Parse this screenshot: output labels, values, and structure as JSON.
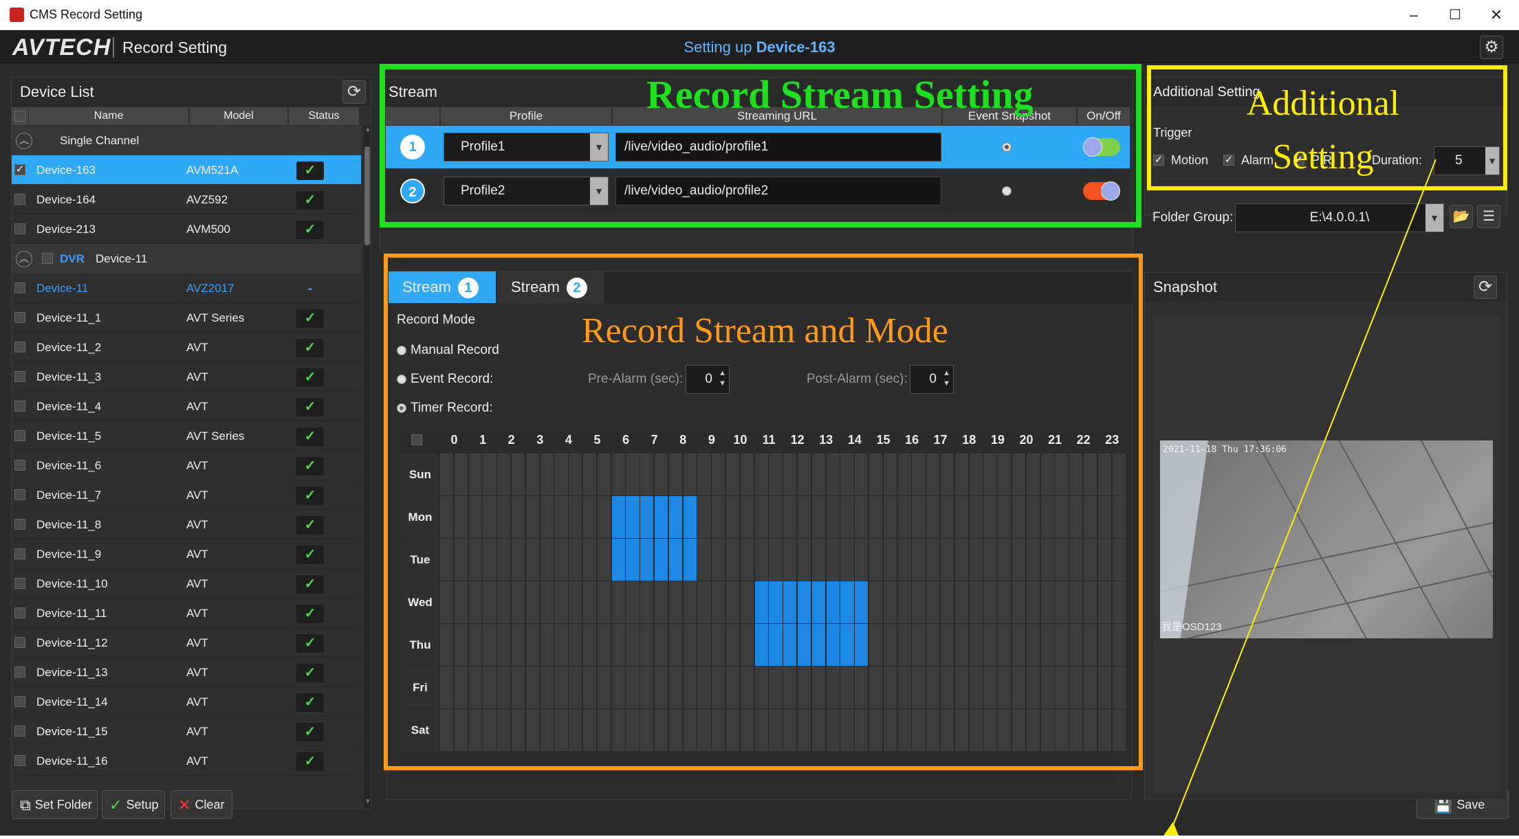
{
  "window": {
    "title": "CMS Record Setting",
    "min": "–",
    "max": "☐",
    "close": "✕"
  },
  "header": {
    "logo": "AVTECH",
    "app_name": "Record Setting",
    "setup_prefix": "Setting up ",
    "device": "Device-163",
    "gear_icon": "gear-icon"
  },
  "device_list": {
    "title": "Device List",
    "columns": [
      "Name",
      "Model",
      "Status"
    ],
    "group1": "Single Channel",
    "single": [
      {
        "name": "Device-163",
        "model": "AVM521A",
        "status": "✓",
        "selected": true,
        "checked": true
      },
      {
        "name": "Device-164",
        "model": "AVZ592",
        "status": "✓"
      },
      {
        "name": "Device-213",
        "model": "AVM500",
        "status": "✓"
      }
    ],
    "group2_type": "DVR",
    "group2_name": "Device-11",
    "dvr": [
      {
        "name": "Device-11",
        "model": "AVZ2017",
        "status": "-",
        "blue": true
      },
      {
        "name": "Device-11_1",
        "model": "AVT Series",
        "status": "✓"
      },
      {
        "name": "Device-11_2",
        "model": "AVT",
        "status": "✓"
      },
      {
        "name": "Device-11_3",
        "model": "AVT",
        "status": "✓"
      },
      {
        "name": "Device-11_4",
        "model": "AVT",
        "status": "✓"
      },
      {
        "name": "Device-11_5",
        "model": "AVT Series",
        "status": "✓"
      },
      {
        "name": "Device-11_6",
        "model": "AVT",
        "status": "✓"
      },
      {
        "name": "Device-11_7",
        "model": "AVT",
        "status": "✓"
      },
      {
        "name": "Device-11_8",
        "model": "AVT",
        "status": "✓"
      },
      {
        "name": "Device-11_9",
        "model": "AVT",
        "status": "✓"
      },
      {
        "name": "Device-11_10",
        "model": "AVT",
        "status": "✓"
      },
      {
        "name": "Device-11_11",
        "model": "AVT",
        "status": "✓"
      },
      {
        "name": "Device-11_12",
        "model": "AVT",
        "status": "✓"
      },
      {
        "name": "Device-11_13",
        "model": "AVT",
        "status": "✓"
      },
      {
        "name": "Device-11_14",
        "model": "AVT",
        "status": "✓"
      },
      {
        "name": "Device-11_15",
        "model": "AVT",
        "status": "✓"
      },
      {
        "name": "Device-11_16",
        "model": "AVT",
        "status": "✓"
      }
    ]
  },
  "buttons": {
    "set_folder": "Set Folder",
    "setup": "Setup",
    "clear": "Clear",
    "save": "Save"
  },
  "stream": {
    "title": "Stream",
    "columns": [
      "Profile",
      "Streaming URL",
      "Event Snapshot",
      "On/Off"
    ],
    "rows": [
      {
        "num": "1",
        "profile": "Profile1",
        "url": "/live/video_audio/profile1",
        "on": true
      },
      {
        "num": "2",
        "profile": "Profile2",
        "url": "/live/video_audio/profile2",
        "on": false
      }
    ]
  },
  "record": {
    "tabs": [
      {
        "label": "Stream",
        "num": "1"
      },
      {
        "label": "Stream",
        "num": "2"
      }
    ],
    "mode_title": "Record Mode",
    "manual": "Manual Record",
    "event": "Event Record:",
    "timer": "Timer Record:",
    "pre_alarm": "Pre-Alarm (sec):",
    "pre_alarm_val": "0",
    "post_alarm": "Post-Alarm (sec):",
    "post_alarm_val": "0",
    "selected_mode": "timer"
  },
  "schedule": {
    "hours": [
      "0",
      "1",
      "2",
      "3",
      "4",
      "5",
      "6",
      "7",
      "8",
      "9",
      "10",
      "11",
      "12",
      "13",
      "14",
      "15",
      "16",
      "17",
      "18",
      "19",
      "20",
      "21",
      "22",
      "23"
    ],
    "days": [
      "Sun",
      "Mon",
      "Tue",
      "Wed",
      "Thu",
      "Fri",
      "Sat"
    ],
    "active": [
      {
        "day": 1,
        "from": 6,
        "to": 8
      },
      {
        "day": 2,
        "from": 6,
        "to": 8
      },
      {
        "day": 3,
        "from": 11,
        "to": 14
      },
      {
        "day": 4,
        "from": 11,
        "to": 14
      }
    ],
    "active_color": "#1e88e5"
  },
  "additional": {
    "title": "Additional Setting",
    "trigger": "Trigger",
    "motion": "Motion",
    "alarm": "Alarm",
    "pir": "PIR",
    "duration_label": "Duration:",
    "duration_val": "5",
    "folder_label": "Folder Group:",
    "folder_val": "E:\\4.0.0.1\\"
  },
  "snapshot": {
    "title": "Snapshot",
    "osd_time": "2021-11-18 Thu 17:36:06",
    "osd_name": "我是OSD123"
  },
  "annotations": {
    "stream_setting": "Record  Stream Setting",
    "stream_mode": "Record Stream and Mode",
    "additional": "Additional Setting",
    "green": "#1fe01f",
    "orange": "#ff9a1a",
    "yellow": "#ffee00"
  }
}
